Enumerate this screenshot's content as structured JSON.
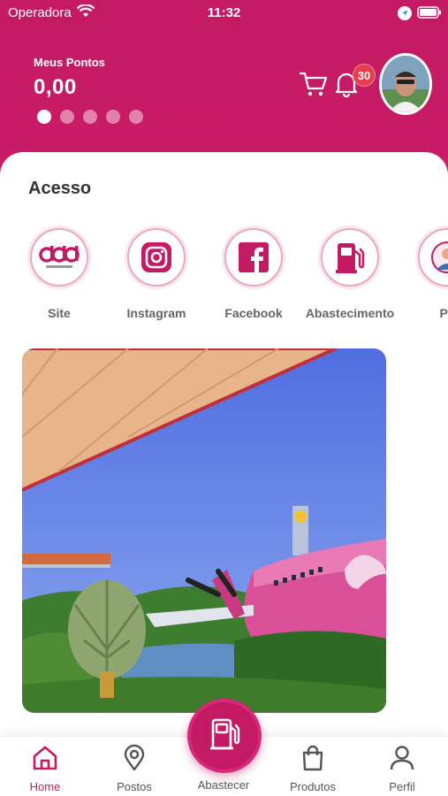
{
  "status_bar": {
    "carrier": "Operadora",
    "time": "11:32"
  },
  "header": {
    "points_label": "Meus Pontos",
    "points_value": "0,00",
    "notification_count": "30",
    "carousel_dots": 5,
    "active_dot": 0
  },
  "access": {
    "title": "Acesso",
    "items": [
      {
        "label": "Site",
        "icon": "ddd-autopostos-logo"
      },
      {
        "label": "Instagram",
        "icon": "instagram-icon"
      },
      {
        "label": "Facebook",
        "icon": "facebook-icon"
      },
      {
        "label": "Abastecimento",
        "icon": "fuel-pump-icon"
      },
      {
        "label": "Pe",
        "icon": "profile-icon"
      }
    ]
  },
  "nav": {
    "items": [
      {
        "label": "Home",
        "icon": "home-icon",
        "active": true
      },
      {
        "label": "Postos",
        "icon": "map-pin-icon"
      },
      {
        "label": "Abastecer",
        "icon": "fuel-pump-icon"
      },
      {
        "label": "Produtos",
        "icon": "shopping-bag-icon"
      },
      {
        "label": "Perfil",
        "icon": "user-icon"
      }
    ]
  },
  "colors": {
    "brand": "#c41a64",
    "badge": "#e53e4f"
  }
}
